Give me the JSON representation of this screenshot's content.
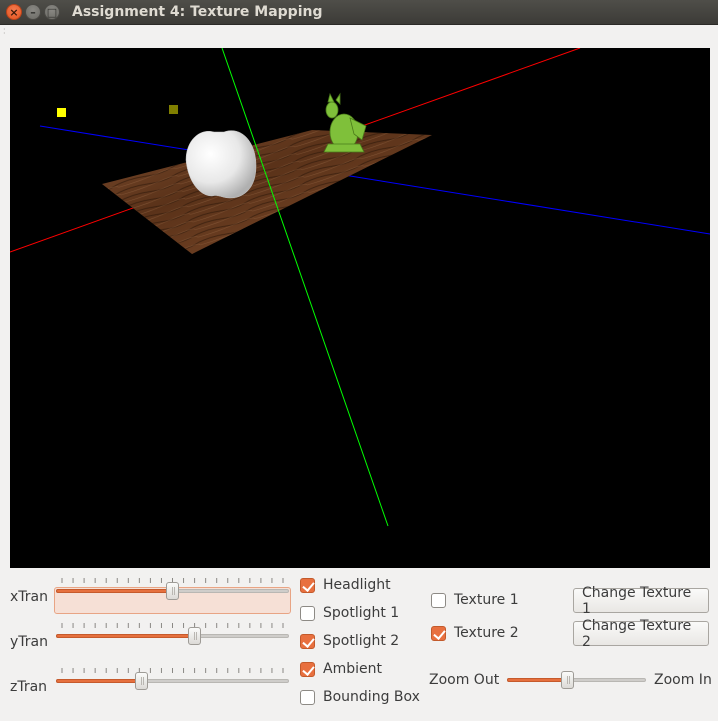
{
  "window": {
    "title": "Assignment 4: Texture Mapping",
    "close_glyph": "×",
    "min_glyph": "–",
    "max_glyph": "□"
  },
  "sliders": {
    "xtran": {
      "label": "xTran",
      "value": 0.5
    },
    "ytran": {
      "label": "yTran",
      "value": 0.6
    },
    "ztran": {
      "label": "zTran",
      "value": 0.36
    }
  },
  "lights": [
    {
      "label": "Headlight",
      "checked": true
    },
    {
      "label": "Spotlight 1",
      "checked": false
    },
    {
      "label": "Spotlight 2",
      "checked": true
    },
    {
      "label": "Ambient",
      "checked": true
    },
    {
      "label": "Bounding Box",
      "checked": false
    }
  ],
  "textures": [
    {
      "label": "Texture 1",
      "checked": false
    },
    {
      "label": "Texture 2",
      "checked": true
    }
  ],
  "buttons": {
    "change_texture_1": "Change Texture 1",
    "change_texture_2": "Change Texture 2"
  },
  "zoom": {
    "out_label": "Zoom Out",
    "in_label": "Zoom In",
    "value": 0.43
  },
  "colors": {
    "accent": "#e8703f",
    "canvas_bg": "#000000",
    "axis_x": "#ff0000",
    "axis_y": "#00ff00",
    "axis_z": "#0000ff",
    "light_marker_1": "#ffff00",
    "light_marker_2": "#807f00"
  }
}
